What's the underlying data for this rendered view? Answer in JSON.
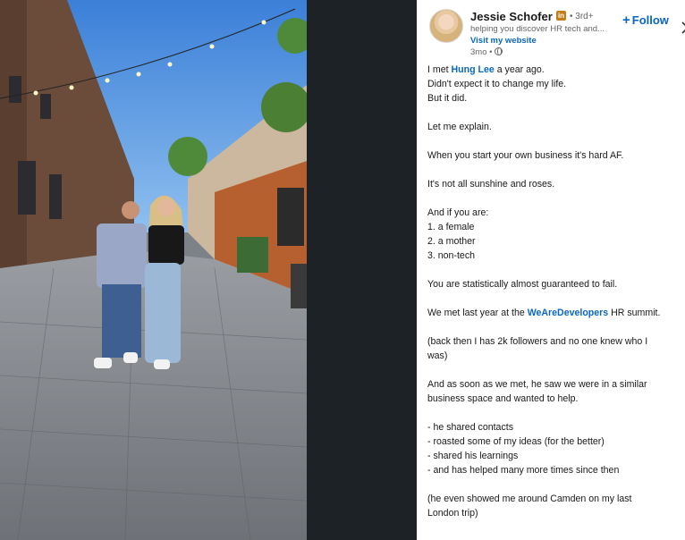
{
  "post": {
    "author": {
      "name": "Jessie Schofer",
      "badge": "in",
      "degree": "• 3rd+",
      "headline": "helping you discover HR tech and...",
      "website_link": "Visit my website",
      "age": "3mo •"
    },
    "follow_label": "Follow",
    "follow_symbol": "+",
    "lines": {
      "l1_a": "I met ",
      "l1_mention": "Hung Lee",
      "l1_b": " a year ago.",
      "l2": "Didn't expect it to change my life.",
      "l3": "But it did.",
      "l4": "Let me explain.",
      "l5": "When you start your own business it's hard AF.",
      "l6": "It's not all sunshine and roses.",
      "l7": "And if you are:",
      "l8": "1. a female",
      "l9": "2. a mother",
      "l10": "3. non-tech",
      "l11": "You are statistically almost guaranteed to fail.",
      "l12_a": "We met last year at the ",
      "l12_mention": "WeAreDevelopers",
      "l12_b": " HR summit.",
      "l13": "(back then I has 2k followers and no one knew who I",
      "l14": "was)",
      "l15": "And as soon as we met, he saw we were in a similar",
      "l16": "business space and wanted to help.",
      "l17": "- he shared contacts",
      "l18": "- roasted some of my ideas (for the better)",
      "l19": "- shared his learnings",
      "l20": "- and has helped many more times since then",
      "l21": "(he even showed me around Camden on my last",
      "l22": "London trip)"
    }
  },
  "colors": {
    "link_blue": "#0a66c2",
    "dark_gap": "#1d2226",
    "linkedin_badge": "#c37d16"
  }
}
